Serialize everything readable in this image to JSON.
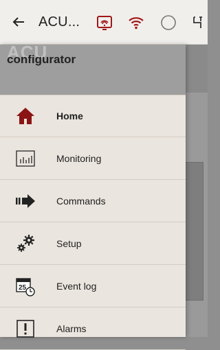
{
  "topbar": {
    "title": "ACU...",
    "icons": [
      "back-arrow-icon",
      "screen-cast-icon",
      "wifi-icon",
      "circle-icon",
      "usb-icon"
    ]
  },
  "drawer": {
    "brand_overlay": "ACU",
    "brand": "configurator",
    "items": [
      {
        "label": "Home",
        "icon": "home-icon"
      },
      {
        "label": "Monitoring",
        "icon": "chart-icon"
      },
      {
        "label": "Commands",
        "icon": "arrow-right-icon"
      },
      {
        "label": "Setup",
        "icon": "gears-icon"
      },
      {
        "label": "Event log",
        "icon": "calendar-clock-icon"
      },
      {
        "label": "Alarms",
        "icon": "alarm-icon"
      }
    ]
  },
  "colors": {
    "accent_red": "#a01818",
    "drawer_bg": "#eae5de",
    "header_bg": "#9e9e9e"
  }
}
